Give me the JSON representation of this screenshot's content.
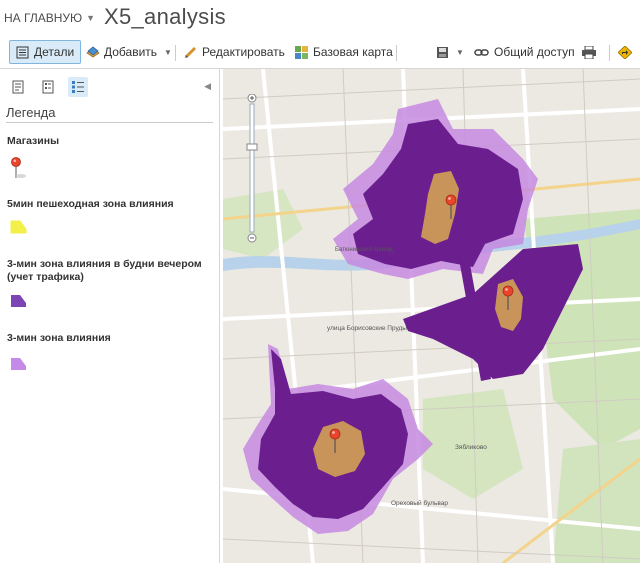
{
  "header": {
    "home_label": "НА ГЛАВНУЮ",
    "title": "X5_analysis"
  },
  "toolbar": {
    "details": "Детали",
    "add": "Добавить",
    "edit": "Редактировать",
    "basemap": "Базовая карта",
    "share": "Общий доступ"
  },
  "sidebar": {
    "legend_title": "Легенда",
    "layers": [
      {
        "name": "Магазины",
        "symbol": "pushpin-icon",
        "color": "#e8452c"
      },
      {
        "name": "5мин пешеходная зона влияния",
        "symbol": "polygon-swatch",
        "color": "#f3f04a"
      },
      {
        "name": "3-мин зона влияния в будни вечером (учет трафика)",
        "symbol": "polygon-swatch",
        "color": "#7c45b5"
      },
      {
        "name": "3-мин зона влияния",
        "symbol": "polygon-swatch",
        "color": "#c58ae8"
      }
    ]
  },
  "map": {
    "street_labels": [
      "улица Борисовские Пруды",
      "Ореховый бульвар",
      "Зябликово",
      "Батюнинский проезд"
    ]
  },
  "colors": {
    "zone_dark": "#6b1f8f",
    "zone_light": "#c68ae0",
    "walk_zone": "#c8945a",
    "marker": "#e8452c",
    "park": "#c9dfb0",
    "water": "#b7d2ea"
  }
}
